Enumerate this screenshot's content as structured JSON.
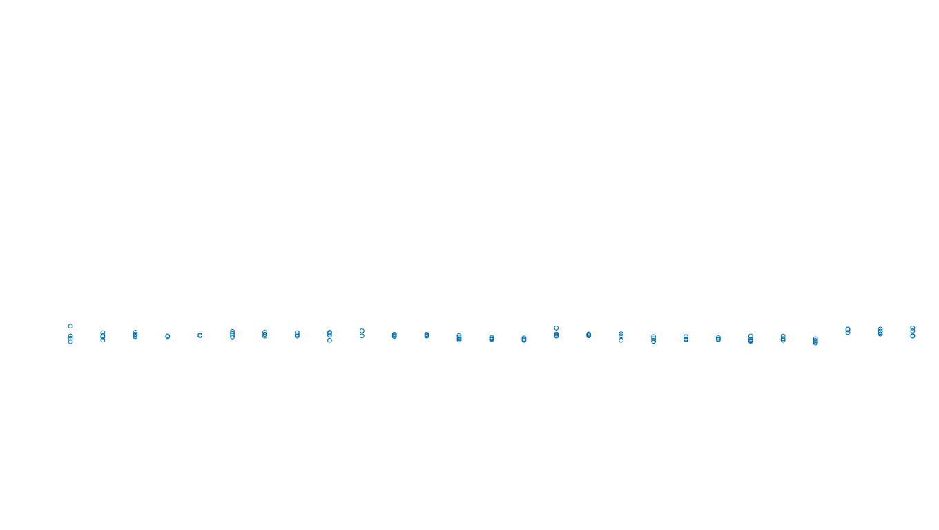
{
  "chart_data": {
    "type": "scatter",
    "title": "",
    "xlabel": "",
    "ylabel": "",
    "grid": false,
    "legend": "none",
    "axes_visible": false,
    "marker": "open-circle",
    "color": "#0072B2",
    "xlim": [
      0.6,
      27.4
    ],
    "ylim": [
      -100,
      100
    ],
    "x": [
      1,
      2,
      3,
      4,
      5,
      6,
      7,
      8,
      9,
      10,
      11,
      12,
      13,
      14,
      15,
      16,
      17,
      18,
      19,
      20,
      21,
      22,
      23,
      24,
      25,
      26,
      27
    ],
    "series": [
      {
        "name": "values",
        "points": [
          {
            "x": 1,
            "y": [
              6.4,
              2.6,
              1.8,
              0.5
            ]
          },
          {
            "x": 2,
            "y": [
              3.9,
              2.8,
              2.3,
              1.1
            ]
          },
          {
            "x": 3,
            "y": [
              4.1,
              3.3,
              2.9,
              2.4
            ]
          },
          {
            "x": 4,
            "y": [
              2.6,
              2.4
            ]
          },
          {
            "x": 5,
            "y": [
              3.0,
              2.8
            ]
          },
          {
            "x": 6,
            "y": [
              4.4,
              3.6,
              3.0,
              2.3
            ]
          },
          {
            "x": 7,
            "y": [
              4.1,
              3.3,
              2.6
            ]
          },
          {
            "x": 8,
            "y": [
              3.9,
              3.1,
              2.6
            ]
          },
          {
            "x": 9,
            "y": [
              4.1,
              3.7,
              3.0,
              1.0
            ]
          },
          {
            "x": 10,
            "y": [
              4.6,
              2.7
            ]
          },
          {
            "x": 11,
            "y": [
              3.3,
              2.9,
              2.5
            ]
          },
          {
            "x": 12,
            "y": [
              3.3,
              2.9,
              2.6
            ]
          },
          {
            "x": 13,
            "y": [
              2.8,
              2.2,
              1.6,
              1.1
            ]
          },
          {
            "x": 14,
            "y": [
              2.1,
              1.6,
              1.3
            ]
          },
          {
            "x": 15,
            "y": [
              1.9,
              1.4,
              1.0
            ]
          },
          {
            "x": 16,
            "y": [
              5.7,
              3.4,
              2.9,
              2.6
            ]
          },
          {
            "x": 17,
            "y": [
              3.4,
              3.1,
              2.7
            ]
          },
          {
            "x": 18,
            "y": [
              3.5,
              2.7,
              1.0
            ]
          },
          {
            "x": 19,
            "y": [
              2.4,
              1.6,
              0.6
            ]
          },
          {
            "x": 20,
            "y": [
              2.4,
              1.5,
              1.2
            ]
          },
          {
            "x": 21,
            "y": [
              2.0,
              1.5,
              1.2
            ]
          },
          {
            "x": 22,
            "y": [
              2.6,
              1.4,
              0.9,
              0.6
            ]
          },
          {
            "x": 23,
            "y": [
              2.6,
              1.6,
              1.0
            ]
          },
          {
            "x": 24,
            "y": [
              1.6,
              0.9,
              0.5,
              0.0
            ]
          },
          {
            "x": 25,
            "y": [
              5.3,
              5.0,
              4.0
            ]
          },
          {
            "x": 26,
            "y": [
              5.3,
              4.5,
              4.0,
              3.4
            ]
          },
          {
            "x": 27,
            "y": [
              5.7,
              4.6,
              2.8,
              2.6
            ]
          }
        ]
      }
    ]
  }
}
